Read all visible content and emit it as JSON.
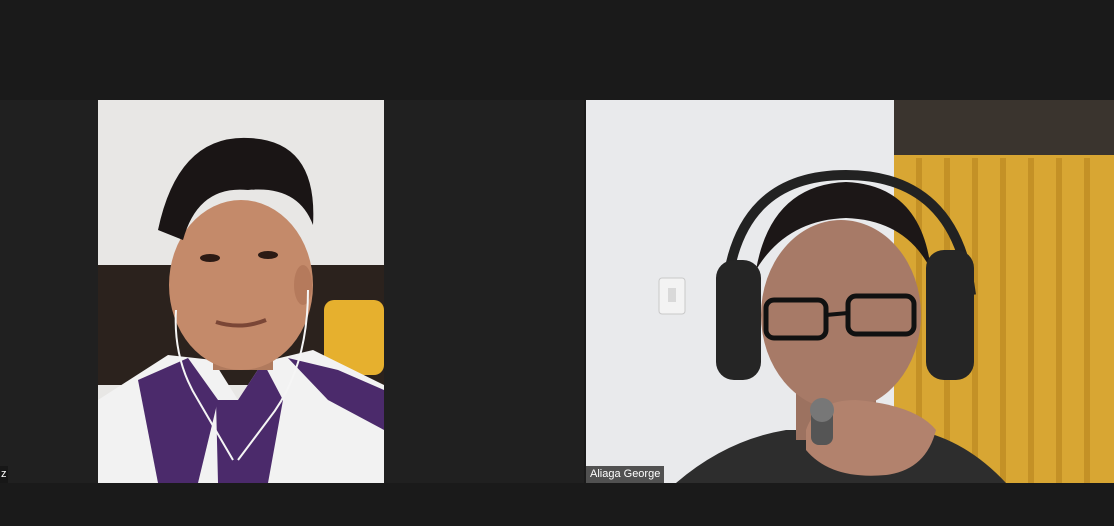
{
  "participants": [
    {
      "name_visible": "z",
      "video": "on"
    },
    {
      "name": "Aliaga George",
      "video": "on"
    }
  ],
  "colors": {
    "background": "#1a1a1a",
    "tile_background": "#202020",
    "name_tag_bg": "#1e1e1e"
  }
}
